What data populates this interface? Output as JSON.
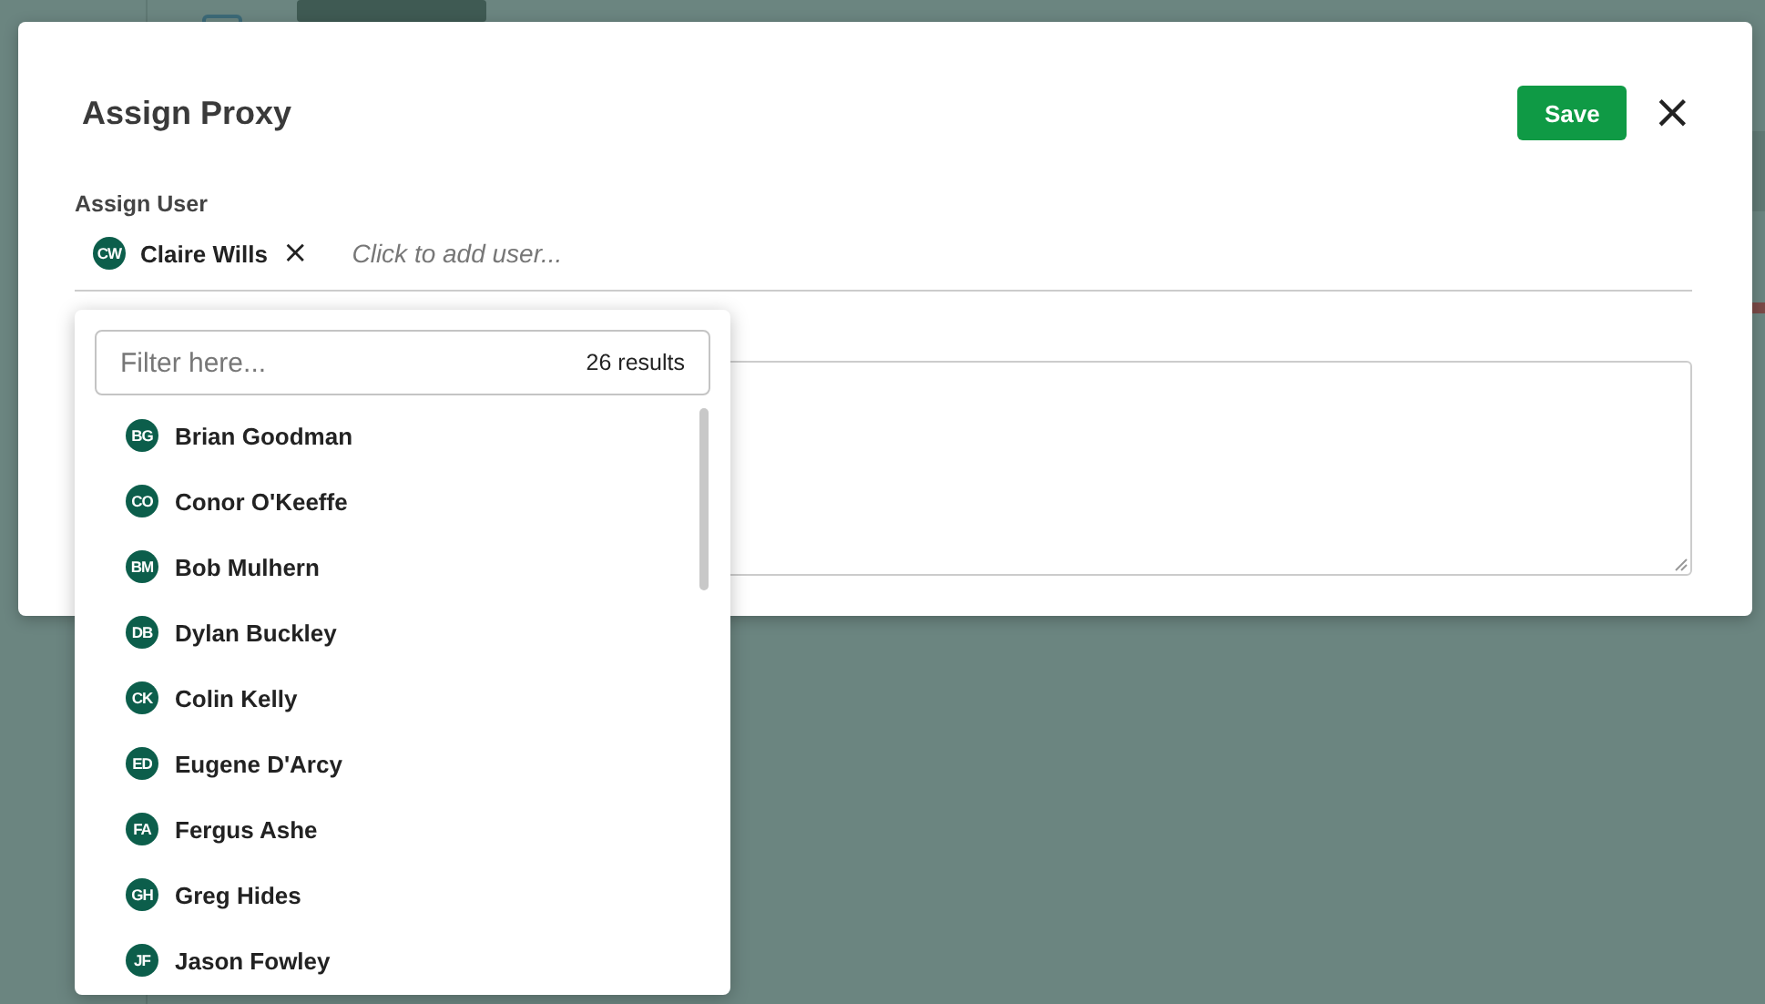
{
  "dialog": {
    "title": "Assign Proxy",
    "save_button": "Save",
    "close_button": "×",
    "assign_user": {
      "label": "Assign User",
      "chips": [
        {
          "initials": "CW",
          "name": "Claire Wills",
          "remove": "×"
        }
      ],
      "placeholder": "Click to add user..."
    },
    "dropdown": {
      "filter_placeholder": "Filter here...",
      "results": "26 results",
      "options": [
        {
          "initials": "BG",
          "name": "Brian Goodman"
        },
        {
          "initials": "CO",
          "name": "Conor O'Keeffe"
        },
        {
          "initials": "BM",
          "name": "Bob Mulhern"
        },
        {
          "initials": "DB",
          "name": "Dylan Buckley"
        },
        {
          "initials": "CK",
          "name": "Colin Kelly"
        },
        {
          "initials": "ED",
          "name": "Eugene D'Arcy"
        },
        {
          "initials": "FA",
          "name": "Fergus Ashe"
        },
        {
          "initials": "GH",
          "name": "Greg Hides"
        },
        {
          "initials": "JF",
          "name": "Jason Fowley"
        }
      ]
    }
  }
}
